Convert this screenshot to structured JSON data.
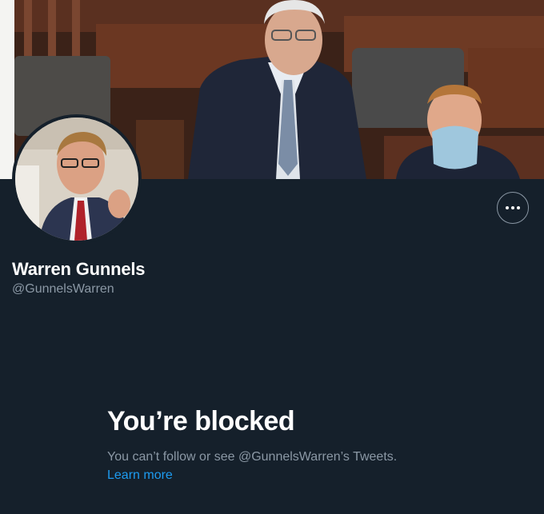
{
  "profile": {
    "display_name": "Warren Gunnels",
    "handle": "@GunnelsWarren"
  },
  "actions": {
    "more_label": "More"
  },
  "blocked": {
    "title": "You’re blocked",
    "message": "You can’t follow or see @GunnelsWarren’s Tweets.",
    "learn_more": "Learn more"
  },
  "icons": {
    "more": "more-horizontal-icon"
  },
  "colors": {
    "background": "#15202b",
    "primary_text": "#ffffff",
    "secondary_text": "#8b98a5",
    "link": "#1d9bf0"
  }
}
